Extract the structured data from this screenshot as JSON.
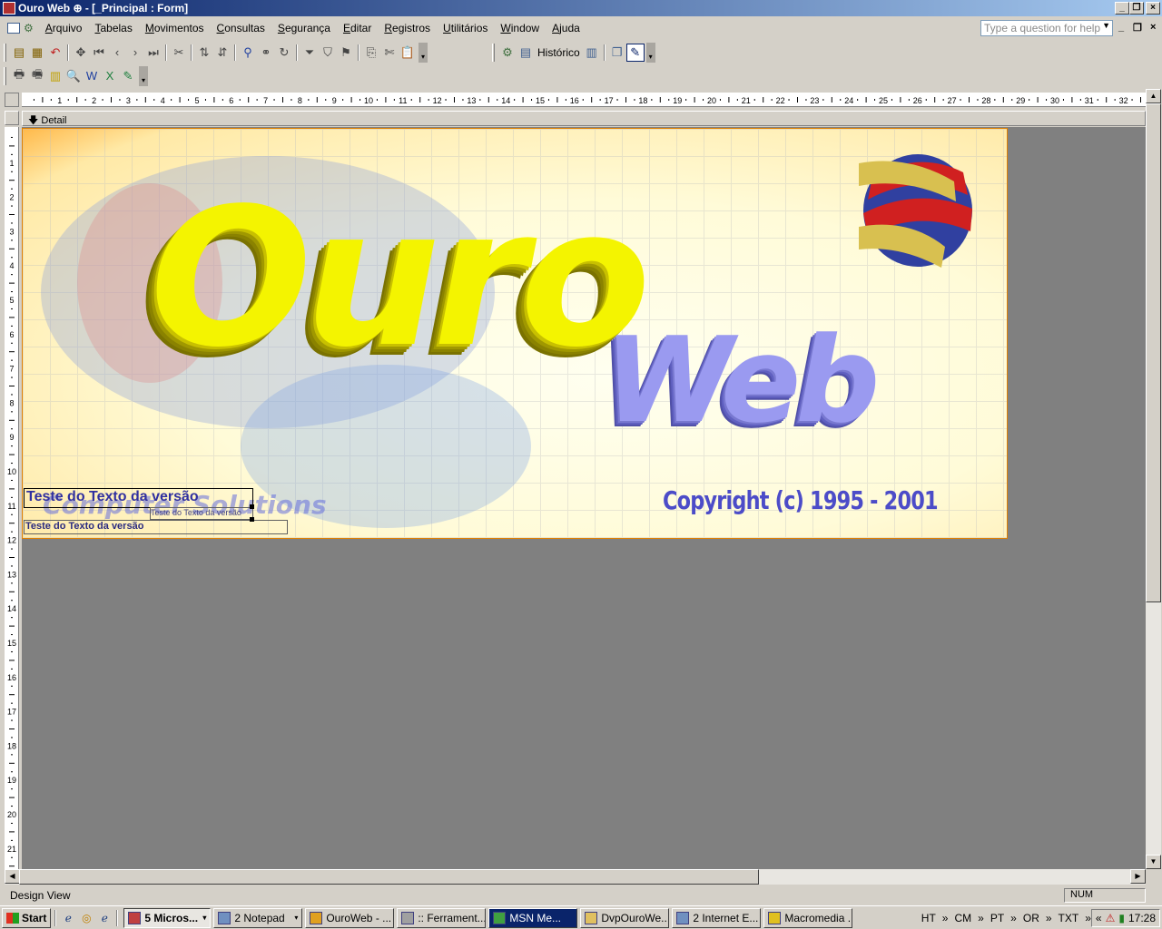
{
  "window": {
    "title": "Ouro Web ⊕ - [_Principal : Form]"
  },
  "menu": [
    "Arquivo",
    "Tabelas",
    "Movimentos",
    "Consultas",
    "Segurança",
    "Editar",
    "Registros",
    "Utilitários",
    "Window",
    "Ajuda"
  ],
  "help": {
    "placeholder": "Type a question for help"
  },
  "toolbar": {
    "historico_label": "Histórico"
  },
  "ruler": {
    "h_ticks": [
      "1",
      "2",
      "3",
      "4",
      "5",
      "6",
      "7",
      "8",
      "9",
      "10",
      "11",
      "12",
      "13",
      "14",
      "15",
      "16",
      "17",
      "18",
      "19",
      "20",
      "21",
      "22",
      "23",
      "24",
      "25",
      "26",
      "27",
      "28",
      "29",
      "30",
      "31",
      "32"
    ],
    "v_ticks": [
      "1",
      "2",
      "3",
      "4",
      "5",
      "6",
      "7",
      "8",
      "9",
      "10",
      "11",
      "12",
      "13",
      "14",
      "15",
      "16",
      "17",
      "18",
      "19",
      "20",
      "21"
    ]
  },
  "section": {
    "label": "Detail"
  },
  "banner": {
    "ouro": "Ouro",
    "web": "Web",
    "copyright": "Copyright (c) 1995 - 2001",
    "ghost": "Computer Solutions"
  },
  "controls": {
    "label1": "Teste do Texto da versão",
    "label2": "Teste do Texto da versão",
    "label3": "Teste do Texto da versão"
  },
  "status": {
    "view": "Design View",
    "num": "NUM"
  },
  "taskbar": {
    "start": "Start",
    "tasks": [
      {
        "label": "5 Micros...",
        "state": "active"
      },
      {
        "label": "2 Notepad",
        "state": "normal"
      },
      {
        "label": "OuroWeb - ...",
        "state": "normal"
      },
      {
        "label": ":: Ferrament...",
        "state": "normal"
      },
      {
        "label": "MSN Me...",
        "state": "dark"
      },
      {
        "label": "DvpOuroWe...",
        "state": "normal"
      },
      {
        "label": "2 Internet E...",
        "state": "normal"
      },
      {
        "label": "Macromedia ...",
        "state": "normal"
      }
    ],
    "langs": [
      "HT",
      "CM",
      "PT",
      "OR",
      "TXT"
    ],
    "time": "17:28"
  }
}
